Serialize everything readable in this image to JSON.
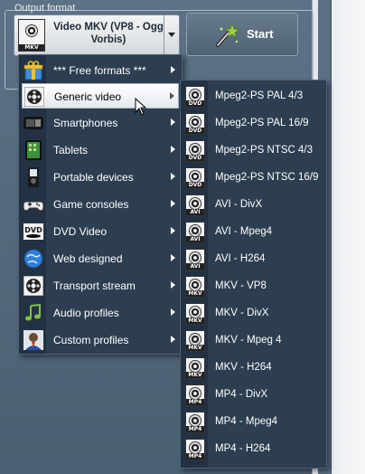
{
  "window": {
    "fieldset_label": "Output format",
    "selected_format": "Video MKV (VP8 - Ogg Vorbis)",
    "selected_icon_tag": "MKV",
    "start_button": "Start"
  },
  "main_menu": {
    "items": [
      {
        "label": "*** Free formats ***",
        "icon": "gift-icon",
        "has_submenu": true
      },
      {
        "label": "Generic video",
        "icon": "film-reel-icon",
        "has_submenu": true,
        "highlighted": true
      },
      {
        "label": "Smartphones",
        "icon": "phone-icon",
        "has_submenu": true
      },
      {
        "label": "Tablets",
        "icon": "tablet-icon",
        "has_submenu": true
      },
      {
        "label": "Portable devices",
        "icon": "portable-player-icon",
        "has_submenu": true
      },
      {
        "label": "Game consoles",
        "icon": "gamepad-icon",
        "has_submenu": true
      },
      {
        "label": "DVD Video",
        "icon": "dvd-logo-icon",
        "has_submenu": true
      },
      {
        "label": "Web designed",
        "icon": "web-globe-icon",
        "has_submenu": true
      },
      {
        "label": "Transport stream",
        "icon": "film-reel-icon",
        "has_submenu": true
      },
      {
        "label": "Audio profiles",
        "icon": "music-note-icon",
        "has_submenu": true
      },
      {
        "label": "Custom profiles",
        "icon": "user-icon",
        "has_submenu": true
      }
    ]
  },
  "sub_menu": {
    "items": [
      {
        "label": "Mpeg2-PS PAL 4/3",
        "tag": "DVD"
      },
      {
        "label": "Mpeg2-PS PAL 16/9",
        "tag": "DVD"
      },
      {
        "label": "Mpeg2-PS NTSC 4/3",
        "tag": "DVD"
      },
      {
        "label": "Mpeg2-PS NTSC 16/9",
        "tag": "DVD"
      },
      {
        "label": "AVI - DivX",
        "tag": "AVI"
      },
      {
        "label": "AVI - Mpeg4",
        "tag": "AVI"
      },
      {
        "label": "AVI - H264",
        "tag": "AVI"
      },
      {
        "label": "MKV - VP8",
        "tag": "MKV"
      },
      {
        "label": "MKV - DivX",
        "tag": "MKV"
      },
      {
        "label": "MKV - Mpeg 4",
        "tag": "MKV"
      },
      {
        "label": "MKV - H264",
        "tag": "MKV"
      },
      {
        "label": "MP4 - DivX",
        "tag": "MP4"
      },
      {
        "label": "MP4 - Mpeg4",
        "tag": "MP4"
      },
      {
        "label": "MP4 - H264",
        "tag": "MP4"
      }
    ]
  },
  "colors": {
    "menu_bg": "#2c3e50",
    "app_bg": "#566b80",
    "highlight": "#ffffff"
  }
}
